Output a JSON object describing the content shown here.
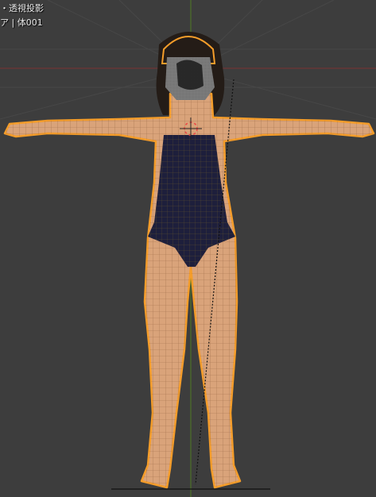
{
  "viewport": {
    "view_label": "・透視投影",
    "object_label": "ア | 体001"
  },
  "colors": {
    "background": "#3d3d3d",
    "grid": "#464646",
    "x_axis": "#8a3a3a",
    "y_axis": "#5c8a24",
    "selection_outline": "#f59d2a",
    "skin": "#d9a37a",
    "swimsuit": "#1e1f3c",
    "hair": "#241c17",
    "mesh_wire": "#3a2a20"
  }
}
